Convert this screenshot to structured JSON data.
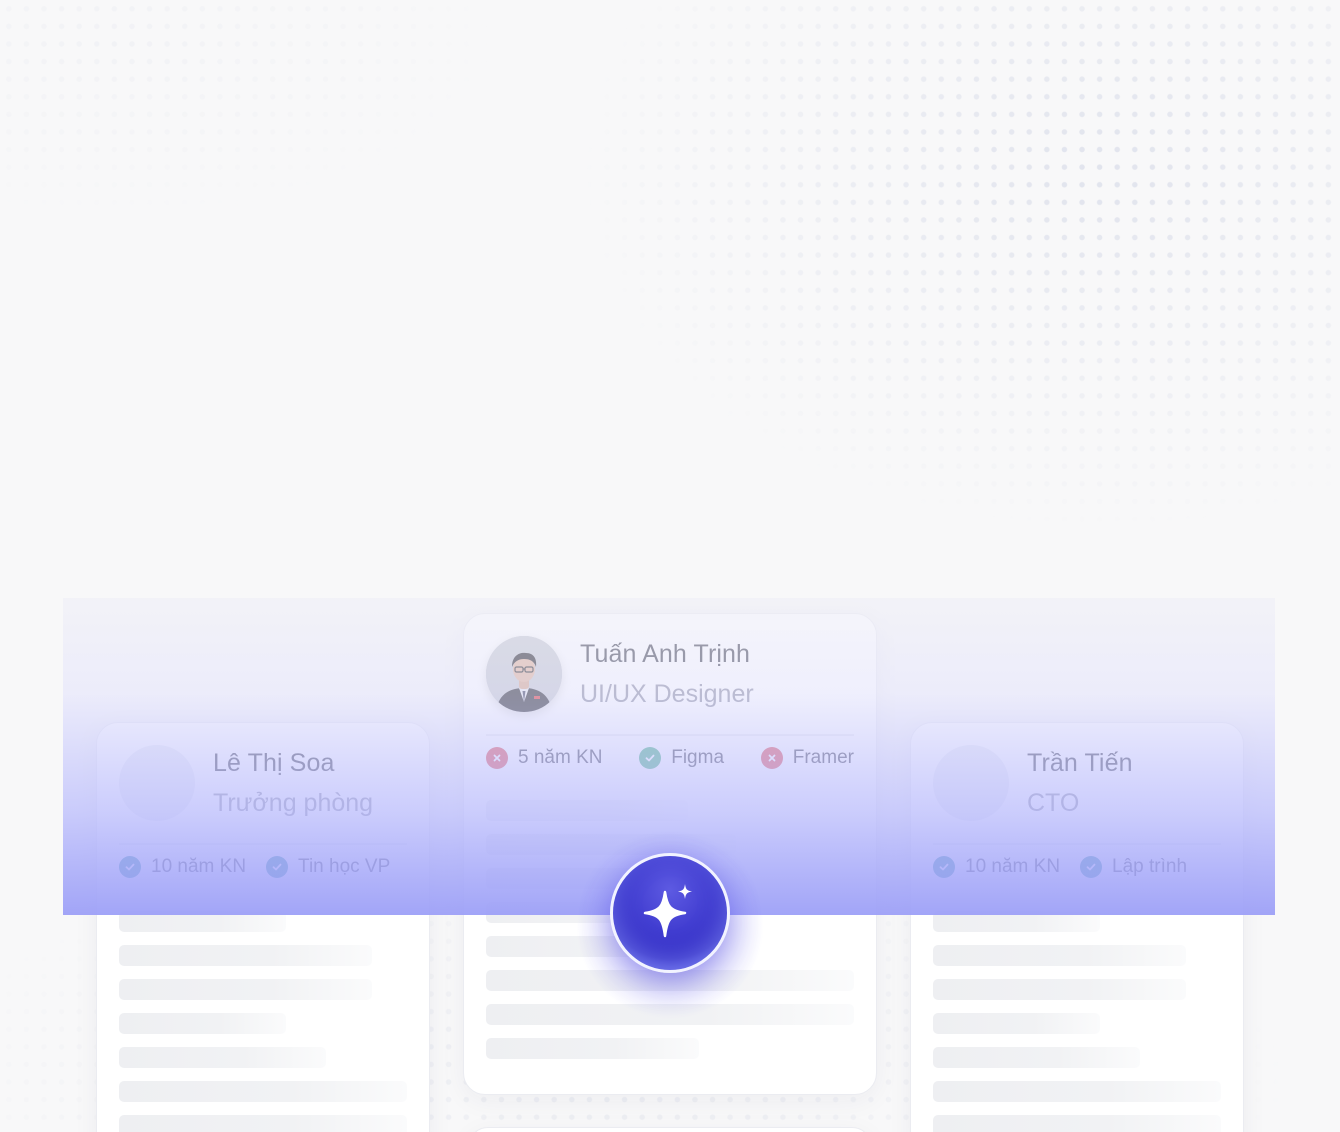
{
  "colors": {
    "accent": "#3f3bcf",
    "check_teal": "#1c8996",
    "check_green": "#3fae7c",
    "cross_red": "#e0474f",
    "band_purple": "#9da0f7"
  },
  "cards": {
    "left": {
      "name": "Lê Thị Soa",
      "role": "Trưởng phòng",
      "tags": [
        {
          "label": "10 năm KN",
          "status": "check"
        },
        {
          "label": "Tin học VP",
          "status": "check"
        }
      ]
    },
    "center": {
      "name": "Tuấn Anh Trịnh",
      "role": "UI/UX Designer",
      "tags": [
        {
          "label": "5 năm KN",
          "status": "cross"
        },
        {
          "label": "Figma",
          "status": "check"
        },
        {
          "label": "Framer",
          "status": "cross"
        }
      ]
    },
    "right": {
      "name": "Trần Tiến",
      "role": "CTO",
      "tags": [
        {
          "label": "10 năm KN",
          "status": "check"
        },
        {
          "label": "Lập trình",
          "status": "check"
        }
      ]
    }
  },
  "ai_button": {
    "icon": "sparkle-icon"
  }
}
